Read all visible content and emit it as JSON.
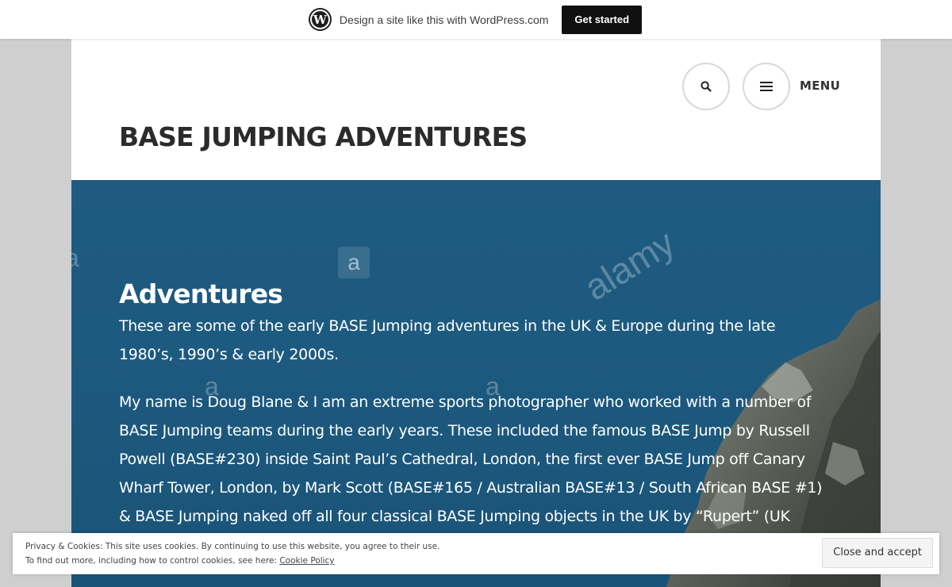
{
  "wp_banner": {
    "text": "Design a site like this with WordPress.com",
    "button_label": "Get started",
    "logo_glyph": "W"
  },
  "header": {
    "menu_label": "MENU",
    "site_title": "BASE JUMPING ADVENTURES"
  },
  "hero": {
    "title": "Adventures",
    "paragraphs": [
      "These are some of the early BASE Jumping adventures in the UK & Europe during the late 1980’s, 1990’s & early 2000s.",
      "My name is Doug Blane & I am an extreme sports photographer who worked with a number of BASE Jumping teams during the early years. These included the famous BASE Jump by Russell Powell (BASE#230) inside Saint Paul’s Cathedral, London, the first ever BASE Jump off Canary Wharf Tower, London, by Mark Scott (BASE#165 / Australian BASE#13 / South African BASE #1) & BASE Jumping naked off all four classical BASE Jumping objects in the UK by “Rupert” (UK"
    ],
    "watermark_text": "alamy",
    "watermark_letter": "a"
  },
  "cookie": {
    "line1": "Privacy & Cookies: This site uses cookies. By continuing to use this website, you agree to their use.",
    "line2_prefix": "To find out more, including how to control cookies, see here: ",
    "link_label": "Cookie Policy",
    "button_label": "Close and accept"
  },
  "colors": {
    "hero_blue": "#1f5b80",
    "banner_button": "#101010"
  }
}
